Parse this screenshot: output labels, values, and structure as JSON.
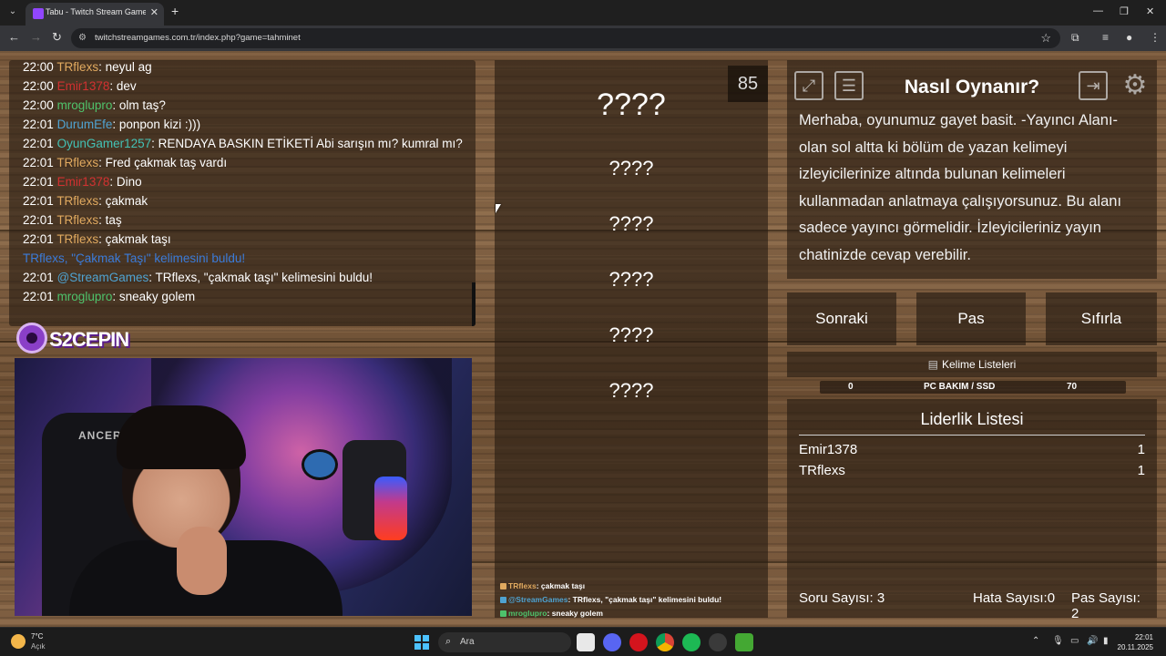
{
  "browser": {
    "tab_title": "Tabu - Twitch Stream Games",
    "url": "twitchstreamgames.com.tr/index.php?game=tahminet"
  },
  "chat": {
    "messages": [
      {
        "time": "22:00",
        "user": "TRflexs",
        "text": ": neyul ag",
        "color": "#e0a95f"
      },
      {
        "time": "22:00",
        "user": "Emir1378",
        "text": ": dev",
        "color": "#d23131"
      },
      {
        "time": "22:00",
        "user": "mroglupro",
        "text": ": olm taş?",
        "color": "#4ec26b"
      },
      {
        "time": "22:01",
        "user": "DurumEfe",
        "text": ": ponpon kizi :)))",
        "color": "#4fa3d1"
      },
      {
        "time": "22:01",
        "user": "OyunGamer1257",
        "text": ": RENDAYA BASKIN ETİKETİ Abi sarışın mı? kumral mı?",
        "color": "#43c2b5"
      },
      {
        "time": "22:01",
        "user": "TRflexs",
        "text": ": Fred çakmak taş vardı",
        "color": "#e0a95f"
      },
      {
        "time": "22:01",
        "user": "Emir1378",
        "text": ": Dino",
        "color": "#d23131"
      },
      {
        "time": "22:01",
        "user": "TRflexs",
        "text": ": çakmak",
        "color": "#e0a95f"
      },
      {
        "time": "22:01",
        "user": "TRflexs",
        "text": ": taş",
        "color": "#e0a95f"
      },
      {
        "time": "22:01",
        "user": "TRflexs",
        "text": ": çakmak taşı",
        "color": "#e0a95f"
      },
      {
        "time": "",
        "user": "",
        "text": "TRflexs, \"Çakmak Taşı\" kelimesini buldu!",
        "color": "#3b7bd9",
        "system": true
      },
      {
        "time": "22:01",
        "user": "@StreamGames",
        "text": ": TRflexs, \"çakmak taşı\" kelimesini buldu!",
        "color": "#4fa3d1"
      },
      {
        "time": "22:01",
        "user": "mroglupro",
        "text": ": sneaky golem",
        "color": "#4ec26b"
      }
    ]
  },
  "logo_text": "S2CEPIN",
  "webcam": {
    "chair_label": "ANCER"
  },
  "words": {
    "counter": "85",
    "main": "????",
    "alternates": [
      "????",
      "????",
      "????",
      "????",
      "????"
    ]
  },
  "overlay_chat": [
    {
      "user": "TRflexs",
      "text": ": çakmak taşı",
      "color": "#e0a95f"
    },
    {
      "user": "@StreamGames",
      "text": ": TRflexs, \"çakmak taşı\" kelimesini buldu!",
      "color": "#4fa3d1"
    },
    {
      "user": "mroglupro",
      "text": ": sneaky golem",
      "color": "#4ec26b"
    }
  ],
  "howto": {
    "title": "Nasıl Oynanır?",
    "description": "Merhaba, oyunumuz gayet basit. -Yayıncı Alanı- olan sol altta ki bölüm de yazan kelimeyi izleyicilerinize altında bulunan kelimeleri kullanmadan anlatmaya çalışıyorsunuz. Bu alanı sadece yayıncı görmelidir. İzleyicileriniz yayın chatinizde cevap verebilir."
  },
  "buttons": {
    "next": "Sonraki",
    "pass": "Pas",
    "reset": "Sıfırla"
  },
  "word_list": {
    "label": "Kelime Listeleri"
  },
  "progress": {
    "current": "0",
    "category": "PC BAKIM / SSD",
    "total": "70"
  },
  "leaderboard": {
    "title": "Liderlik Listesi",
    "rows": [
      {
        "name": "Emir1378",
        "score": "1"
      },
      {
        "name": "TRflexs",
        "score": "1"
      }
    ],
    "questions_label": "Soru Sayısı:",
    "questions": "3",
    "errors_label": "Hata Sayısı:",
    "errors": "0",
    "passes_label": "Pas Sayısı:",
    "passes": "2"
  },
  "taskbar": {
    "temp": "7°C",
    "condition": "Açık",
    "search_placeholder": "Ara",
    "time": "22:01",
    "date": "20.11.2025"
  }
}
